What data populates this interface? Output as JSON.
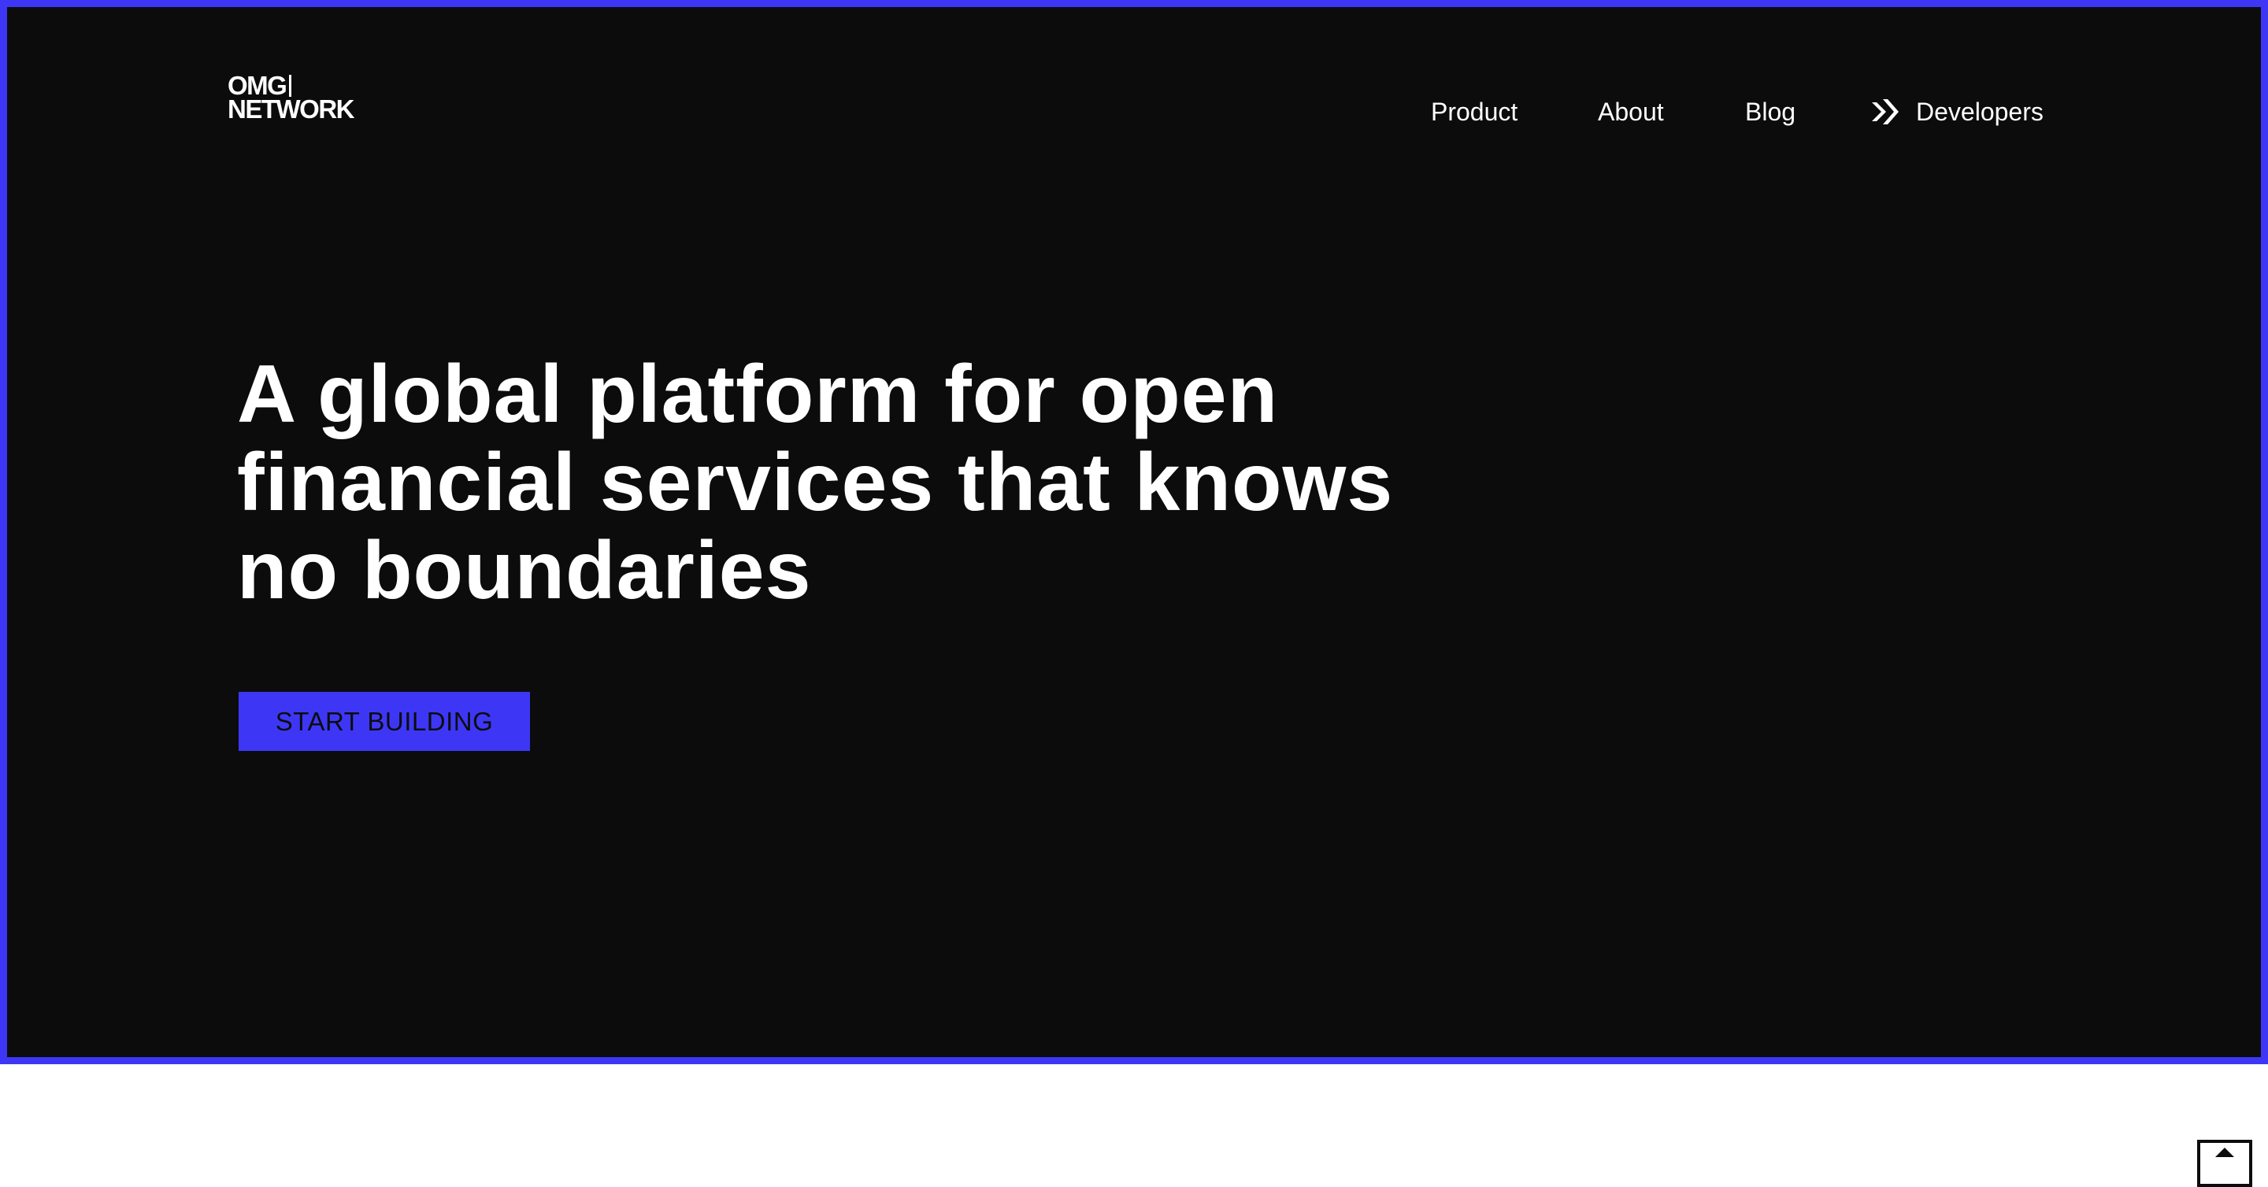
{
  "brand": {
    "logo_line1": "OMG",
    "logo_line2": "NETWORK"
  },
  "nav": {
    "items": [
      {
        "label": "Product"
      },
      {
        "label": "About"
      },
      {
        "label": "Blog"
      },
      {
        "label": "Developers",
        "icon": "developers-icon"
      }
    ]
  },
  "hero": {
    "headline": "A global platform for open financial services that knows no boundaries",
    "cta_label": "START BUILDING"
  },
  "colors": {
    "accent": "#3d37f5",
    "background": "#0c0c0d",
    "text": "#ffffff"
  },
  "icons": {
    "scroll_top": "chevron-up-icon"
  }
}
